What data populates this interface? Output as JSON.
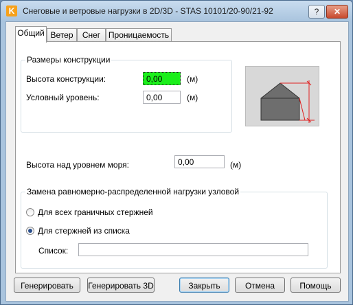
{
  "window": {
    "title": "Снеговые и ветровые нагрузки в 2D/3D - STAS 10101/20-90/21-92",
    "help_label": "?",
    "close_label": "✕",
    "app_icon_letter": "K"
  },
  "tabs": [
    {
      "label": "Общий",
      "active": true
    },
    {
      "label": "Ветер",
      "active": false
    },
    {
      "label": "Снег",
      "active": false
    },
    {
      "label": "Проницаемость",
      "active": false
    }
  ],
  "dimensions_group": {
    "title": "Размеры конструкции",
    "height_label": "Высота конструкции:",
    "height_value": "0,00",
    "height_unit": "(м)",
    "level_label": "Условный уровень:",
    "level_value": "0,00",
    "level_unit": "(м)"
  },
  "altitude": {
    "label": "Высота над уровнем моря:",
    "value": "0,00",
    "unit": "(м)"
  },
  "replacement_group": {
    "title": "Замена равномерно-распределенной нагрузки узловой",
    "option_all": "Для всех граничных стержней",
    "option_list": "Для стержней из списка",
    "selected": "option_list",
    "list_label": "Список:",
    "list_value": ""
  },
  "buttons": {
    "generate": "Генерировать",
    "generate_3d": "Генерировать 3D",
    "close": "Закрыть",
    "cancel": "Отмена",
    "help": "Помощь"
  },
  "colors": {
    "highlight_field": "#1bef1b",
    "dimension_marker": "#e02020",
    "house": "#6e6e6e"
  }
}
